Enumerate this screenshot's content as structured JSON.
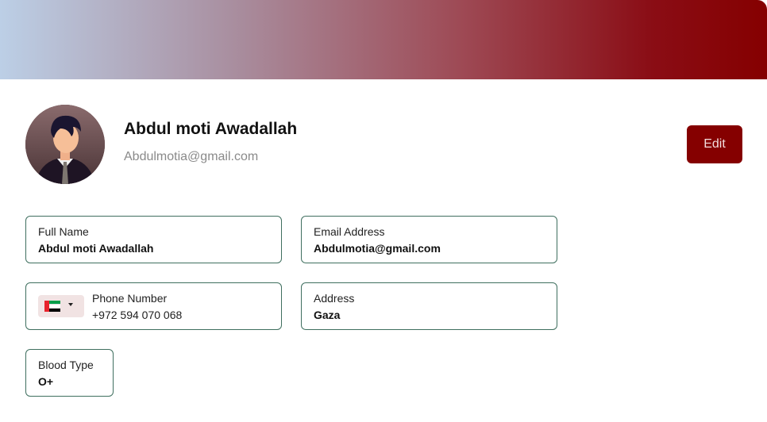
{
  "profile": {
    "name": "Abdul moti Awadallah",
    "email": "Abdulmotia@gmail.com",
    "edit_label": "Edit"
  },
  "fields": {
    "full_name": {
      "label": "Full Name",
      "value": "Abdul moti Awadallah"
    },
    "email": {
      "label": "Email Address",
      "value": "Abdulmotia@gmail.com"
    },
    "phone": {
      "label": "Phone Number",
      "value": "+972 594 070 068",
      "country_flag": "uae-flag-icon"
    },
    "address": {
      "label": "Address",
      "value": "Gaza"
    },
    "blood_type": {
      "label": "Blood Type",
      "value": "O+"
    }
  },
  "colors": {
    "accent": "#850000",
    "field_border": "#3f6f5f"
  }
}
